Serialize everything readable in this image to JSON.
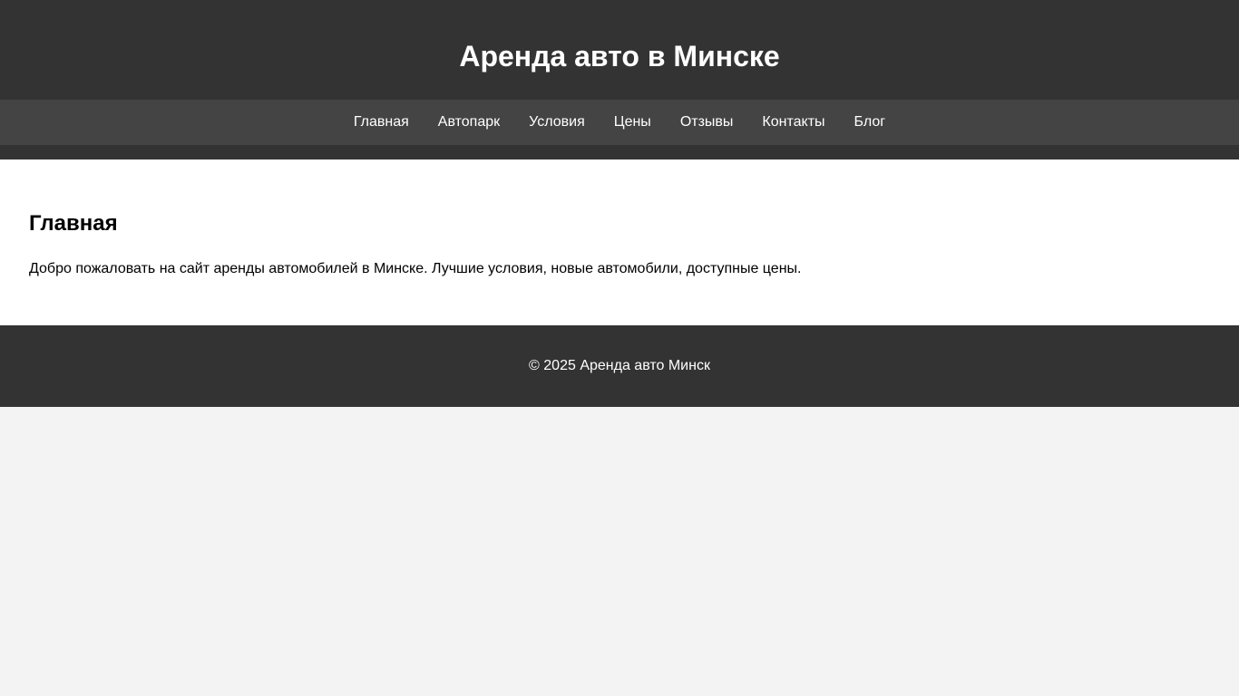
{
  "header": {
    "title": "Аренда авто в Минске"
  },
  "nav": {
    "items": [
      {
        "label": "Главная"
      },
      {
        "label": "Автопарк"
      },
      {
        "label": "Условия"
      },
      {
        "label": "Цены"
      },
      {
        "label": "Отзывы"
      },
      {
        "label": "Контакты"
      },
      {
        "label": "Блог"
      }
    ]
  },
  "main": {
    "heading": "Главная",
    "intro": "Добро пожаловать на сайт аренды автомобилей в Минске. Лучшие условия, новые автомобили, доступные цены."
  },
  "footer": {
    "copyright": "© 2025 Аренда авто Минск"
  },
  "colors": {
    "header_bg": "#333333",
    "nav_bg": "#444444",
    "content_bg": "#ffffff",
    "page_bg": "#f3f3f3",
    "text_light": "#ffffff"
  }
}
